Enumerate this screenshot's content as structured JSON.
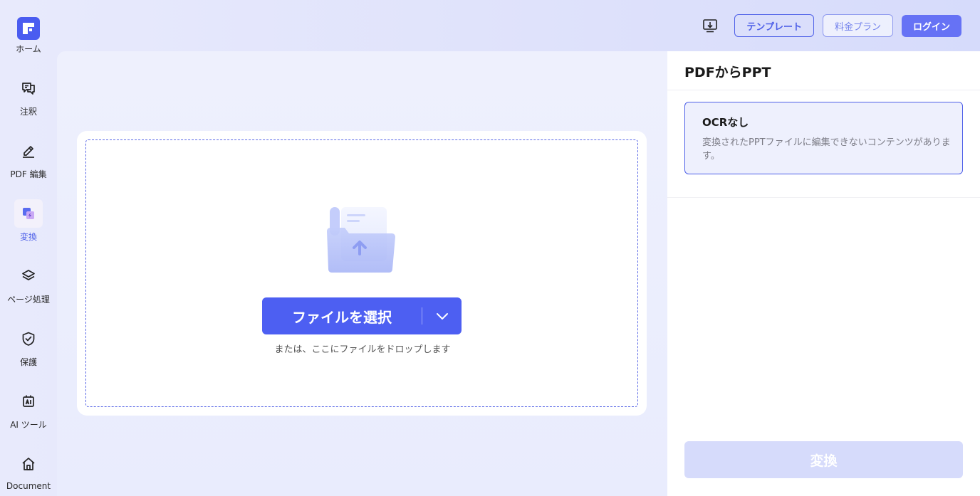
{
  "sidebar": {
    "items": [
      {
        "label": "ホーム",
        "icon": "home-logo-icon",
        "active": false
      },
      {
        "label": "注釈",
        "icon": "comment-icon",
        "active": false
      },
      {
        "label": "PDF 編集",
        "icon": "edit-pen-icon",
        "active": false
      },
      {
        "label": "変換",
        "icon": "convert-icon",
        "active": true
      },
      {
        "label": "ページ処理",
        "icon": "layers-icon",
        "active": false
      },
      {
        "label": "保護",
        "icon": "shield-icon",
        "active": false
      },
      {
        "label": "AI ツール",
        "icon": "ai-tool-icon",
        "active": false
      },
      {
        "label": "Document",
        "icon": "house-icon",
        "active": false
      }
    ]
  },
  "header": {
    "template_label": "テンプレート",
    "pricing_label": "料金プラン",
    "login_label": "ログイン"
  },
  "upload": {
    "select_label": "ファイルを選択",
    "drop_hint": "または、ここにファイルをドロップします"
  },
  "options": {
    "title": "PDFからPPT",
    "ocr_title": "OCRなし",
    "ocr_desc": "変換されたPPTファイルに編集できないコンテンツがあります。",
    "convert_label": "変換"
  },
  "colors": {
    "accent": "#4d5fe8",
    "button": "#4d5ff2",
    "disabled": "#d6dbfb"
  }
}
